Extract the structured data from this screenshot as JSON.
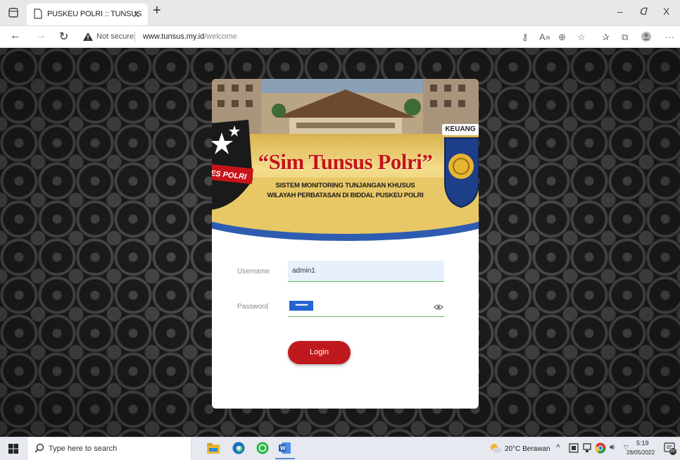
{
  "browser": {
    "tab_title": "PUSKEU POLRI :: TUNSUS",
    "tab_close": "x",
    "new_tab": "+",
    "win_minimize": "–",
    "win_restore": "ᗡ",
    "win_close": "X",
    "security_text": "Not secure",
    "url_host": "www.tunsus.my.id",
    "url_path": "/welcome",
    "more_menu": "···"
  },
  "banner": {
    "main_title": "“Sim Tunsus Polri”",
    "subtitle_line1": "SISTEM MONITORING TUNJANGAN KHUSUS",
    "subtitle_line2": "WILAYAH PERBATASAN DI BIDDAL PUSKEU POLRI",
    "left_badge_text": "ES POLRI",
    "right_tag": "KEUANG"
  },
  "form": {
    "username_label": "Username",
    "username_value": "admin1",
    "password_label": "Password",
    "password_mask": "••••••••",
    "login_label": "Login"
  },
  "taskbar": {
    "search_placeholder": "Type here to search",
    "weather": "20°C  Berawan",
    "time": "5:19",
    "date": "28/05/2022",
    "notif_count": "20"
  },
  "colors": {
    "accent_red": "#c0191d",
    "input_focus_green": "#5fb95f",
    "autofill_blue": "#e8f0fe"
  }
}
